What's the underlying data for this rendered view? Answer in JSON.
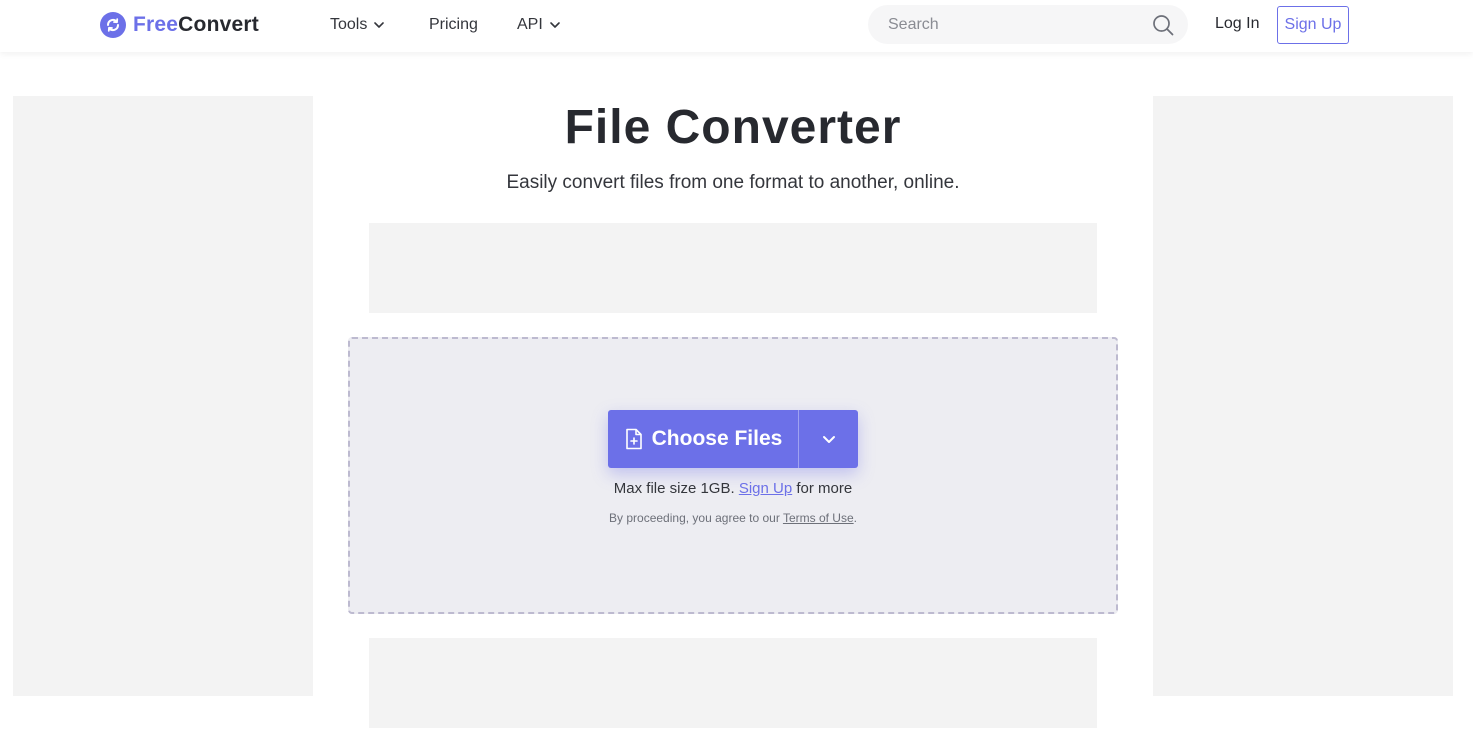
{
  "header": {
    "logo": {
      "free": "Free",
      "convert": "Convert",
      "icon": "refresh-icon"
    },
    "nav": [
      {
        "label": "Tools",
        "has_dropdown": true
      },
      {
        "label": "Pricing",
        "has_dropdown": false
      },
      {
        "label": "API",
        "has_dropdown": true
      }
    ],
    "search": {
      "placeholder": "Search",
      "value": "",
      "icon": "search-icon"
    },
    "login_label": "Log In",
    "signup_label": "Sign Up"
  },
  "main": {
    "title": "File Converter",
    "subtitle": "Easily convert files from one format to another, online.",
    "upload": {
      "choose_label": "Choose Files",
      "choose_icon": "file-plus-icon",
      "toggle_icon": "chevron-down-icon",
      "limit_prefix": "Max file size 1GB.",
      "limit_link": "Sign Up",
      "limit_suffix": "for more",
      "terms_prefix": "By proceeding, you agree to our",
      "terms_link": "Terms of Use",
      "terms_suffix": "."
    }
  },
  "colors": {
    "accent": "#6c70e8",
    "text": "#27292f",
    "dropzone_bg": "#ededf2",
    "dropzone_border": "#bdbad0",
    "ad_bg": "#f3f3f3"
  }
}
